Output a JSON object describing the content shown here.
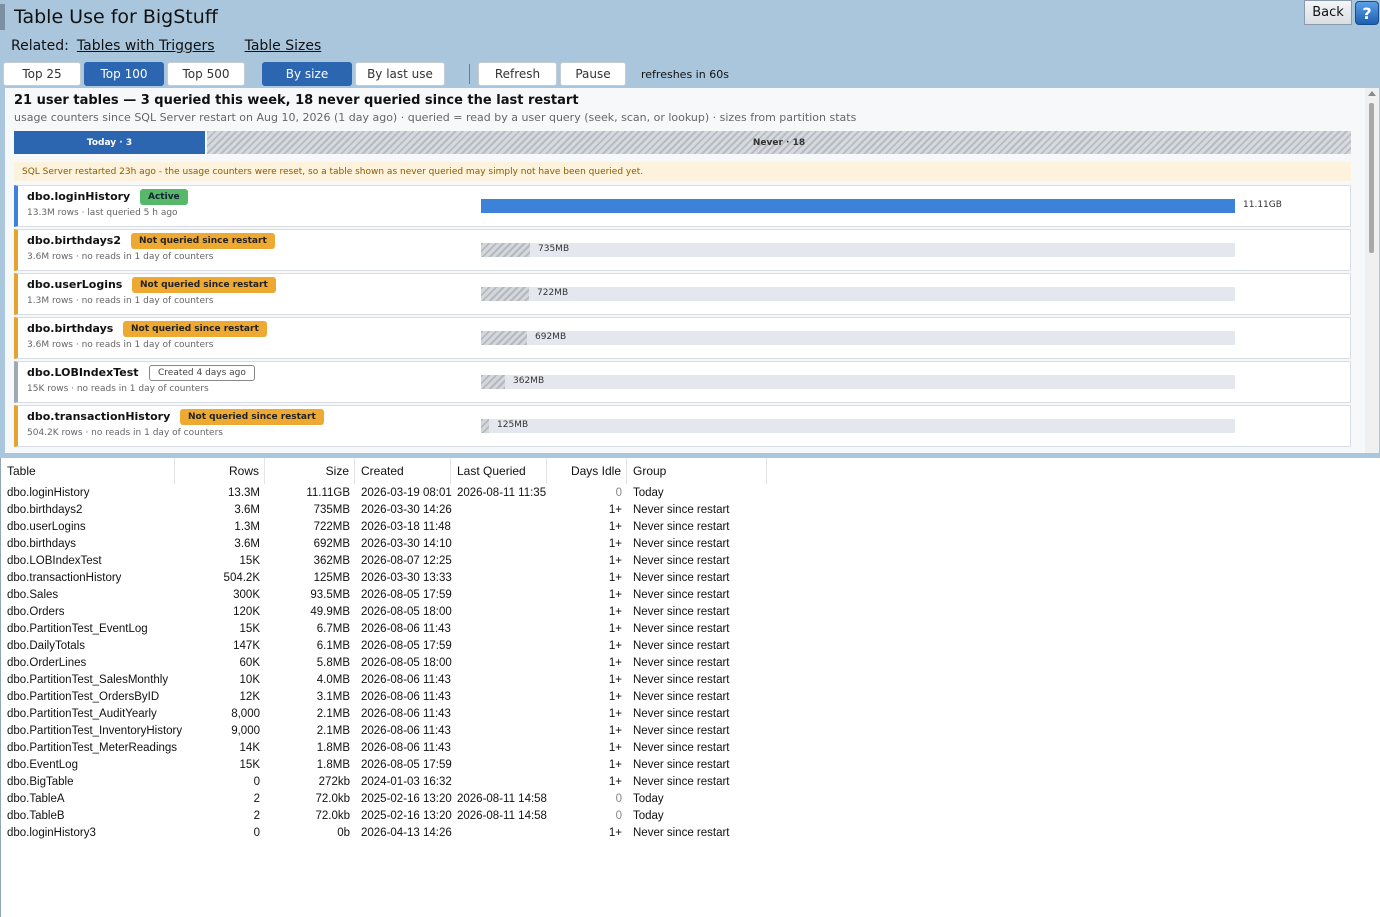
{
  "header": {
    "title": "Table Use for BigStuff",
    "related_label": "Related:",
    "related_links": [
      "Tables with Triggers",
      "Table Sizes"
    ],
    "back_label": "Back",
    "help_label": "?"
  },
  "toolbar": {
    "top_buttons": [
      "Top 25",
      "Top 100",
      "Top 500"
    ],
    "top_selected": "Top 100",
    "sort_buttons": [
      "By size",
      "By last use"
    ],
    "sort_selected": "By size",
    "refresh_label": "Refresh",
    "pause_label": "Pause",
    "refresh_note": "refreshes in 60s"
  },
  "summary": {
    "title": "21 user tables — 3 queried this week, 18 never queried since the last restart",
    "subtitle": "usage counters since SQL Server restart on Aug 10, 2026 (1 day ago)   ·   queried = read by a user query (seek, scan, or lookup)   ·   sizes from partition stats",
    "today_label": "Today · 3",
    "never_label": "Never · 18",
    "today_count": 3,
    "never_count": 18,
    "warning": "SQL Server restarted 23h ago - the usage counters were reset, so a table shown as never queried may simply not have been queried yet."
  },
  "cards": [
    {
      "name": "dbo.loginHistory",
      "badge": "Active",
      "badge_style": "green",
      "meta": "13.3M rows · last queried 5 h ago",
      "size_label": "11.11GB",
      "size_fraction": 1.0,
      "kind": "active"
    },
    {
      "name": "dbo.birthdays2",
      "badge": "Not queried since restart",
      "badge_style": "orange",
      "meta": "3.6M rows · no reads in 1 day of counters",
      "size_label": "735MB",
      "size_fraction": 0.065,
      "kind": "never"
    },
    {
      "name": "dbo.userLogins",
      "badge": "Not queried since restart",
      "badge_style": "orange",
      "meta": "1.3M rows · no reads in 1 day of counters",
      "size_label": "722MB",
      "size_fraction": 0.063,
      "kind": "never"
    },
    {
      "name": "dbo.birthdays",
      "badge": "Not queried since restart",
      "badge_style": "orange",
      "meta": "3.6M rows · no reads in 1 day of counters",
      "size_label": "692MB",
      "size_fraction": 0.061,
      "kind": "never"
    },
    {
      "name": "dbo.LOBIndexTest",
      "badge": "Created 4 days ago",
      "badge_style": "outline",
      "meta": "15K rows · no reads in 1 day of counters",
      "size_label": "362MB",
      "size_fraction": 0.032,
      "kind": "created"
    },
    {
      "name": "dbo.transactionHistory",
      "badge": "Not queried since restart",
      "badge_style": "orange",
      "meta": "504.2K rows · no reads in 1 day of counters",
      "size_label": "125MB",
      "size_fraction": 0.011,
      "kind": "never"
    }
  ],
  "grid": {
    "columns": [
      "Table",
      "Rows",
      "Size",
      "Created",
      "Last Queried",
      "Days Idle",
      "Group"
    ],
    "rows": [
      [
        "dbo.loginHistory",
        "13.3M",
        "11.11GB",
        "2026-03-19 08:01",
        "2026-08-11 11:35",
        "0",
        "Today"
      ],
      [
        "dbo.birthdays2",
        "3.6M",
        "735MB",
        "2026-03-30 14:26",
        "",
        "1+",
        "Never since restart"
      ],
      [
        "dbo.userLogins",
        "1.3M",
        "722MB",
        "2026-03-18 11:48",
        "",
        "1+",
        "Never since restart"
      ],
      [
        "dbo.birthdays",
        "3.6M",
        "692MB",
        "2026-03-30 14:10",
        "",
        "1+",
        "Never since restart"
      ],
      [
        "dbo.LOBIndexTest",
        "15K",
        "362MB",
        "2026-08-07 12:25",
        "",
        "1+",
        "Never since restart"
      ],
      [
        "dbo.transactionHistory",
        "504.2K",
        "125MB",
        "2026-03-30 13:33",
        "",
        "1+",
        "Never since restart"
      ],
      [
        "dbo.Sales",
        "300K",
        "93.5MB",
        "2026-08-05 17:59",
        "",
        "1+",
        "Never since restart"
      ],
      [
        "dbo.Orders",
        "120K",
        "49.9MB",
        "2026-08-05 18:00",
        "",
        "1+",
        "Never since restart"
      ],
      [
        "dbo.PartitionTest_EventLog",
        "15K",
        "6.7MB",
        "2026-08-06 11:43",
        "",
        "1+",
        "Never since restart"
      ],
      [
        "dbo.DailyTotals",
        "147K",
        "6.1MB",
        "2026-08-05 17:59",
        "",
        "1+",
        "Never since restart"
      ],
      [
        "dbo.OrderLines",
        "60K",
        "5.8MB",
        "2026-08-05 18:00",
        "",
        "1+",
        "Never since restart"
      ],
      [
        "dbo.PartitionTest_SalesMonthly",
        "10K",
        "4.0MB",
        "2026-08-06 11:43",
        "",
        "1+",
        "Never since restart"
      ],
      [
        "dbo.PartitionTest_OrdersByID",
        "12K",
        "3.1MB",
        "2026-08-06 11:43",
        "",
        "1+",
        "Never since restart"
      ],
      [
        "dbo.PartitionTest_AuditYearly",
        "8,000",
        "2.1MB",
        "2026-08-06 11:43",
        "",
        "1+",
        "Never since restart"
      ],
      [
        "dbo.PartitionTest_InventoryHistory",
        "9,000",
        "2.1MB",
        "2026-08-06 11:43",
        "",
        "1+",
        "Never since restart"
      ],
      [
        "dbo.PartitionTest_MeterReadings",
        "14K",
        "1.8MB",
        "2026-08-06 11:43",
        "",
        "1+",
        "Never since restart"
      ],
      [
        "dbo.EventLog",
        "15K",
        "1.8MB",
        "2026-08-05 17:59",
        "",
        "1+",
        "Never since restart"
      ],
      [
        "dbo.BigTable",
        "0",
        "272kb",
        "2024-01-03 16:32",
        "",
        "1+",
        "Never since restart"
      ],
      [
        "dbo.TableA",
        "2",
        "72.0kb",
        "2025-02-16 13:20",
        "2026-08-11 14:58",
        "0",
        "Today"
      ],
      [
        "dbo.TableB",
        "2",
        "72.0kb",
        "2025-02-16 13:20",
        "2026-08-11 14:58",
        "0",
        "Today"
      ],
      [
        "dbo.loginHistory3",
        "0",
        "0b",
        "2026-04-13 14:26",
        "",
        "1+",
        "Never since restart"
      ]
    ]
  }
}
